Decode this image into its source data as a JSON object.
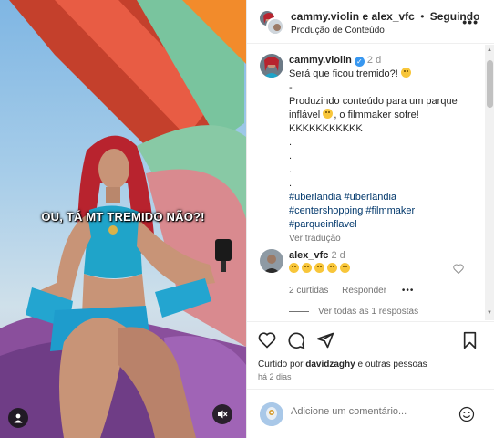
{
  "media": {
    "caption": "OU, TÁ MT TREMIDO NÃO?!",
    "profile_icon": "person-icon",
    "mute_icon": "speaker-muted-icon"
  },
  "header": {
    "users": "cammy.violin e alex_vfc",
    "separator": "•",
    "follow_status": "Seguindo",
    "subtitle": "Produção de Conteúdo",
    "more_icon": "ellipsis-icon"
  },
  "caption_comment": {
    "username": "cammy.violin",
    "time": "2 d",
    "lines": [
      "Será que ficou tremido?!",
      "-",
      "Produzindo conteúdo para um parque",
      "inflável",
      "KKKKKKKKKKK",
      ".",
      ".",
      ".",
      ".",
      "#uberlandia #uberlândia",
      "#centershopping #filmmaker",
      "#parqueinflavel"
    ],
    "line4_suffix": ", o filmmaker sofre!",
    "see_translation": "Ver tradução"
  },
  "reply_comment": {
    "username": "alex_vfc",
    "time": "2 d",
    "emoji_count": 5,
    "likes": "2 curtidas",
    "reply": "Responder",
    "more": "•••"
  },
  "view_replies": "Ver todas as 1 respostas",
  "actions": {
    "liked_by_prefix": "Curtido por",
    "liked_by_user": "davidzaghy",
    "liked_by_suffix": "e outras pessoas",
    "ago": "há 2 dias"
  },
  "comment_box": {
    "placeholder": "Adicione um comentário..."
  },
  "colors": {
    "verified": "#3897f0",
    "link": "#00376b",
    "muted": "#737373"
  }
}
